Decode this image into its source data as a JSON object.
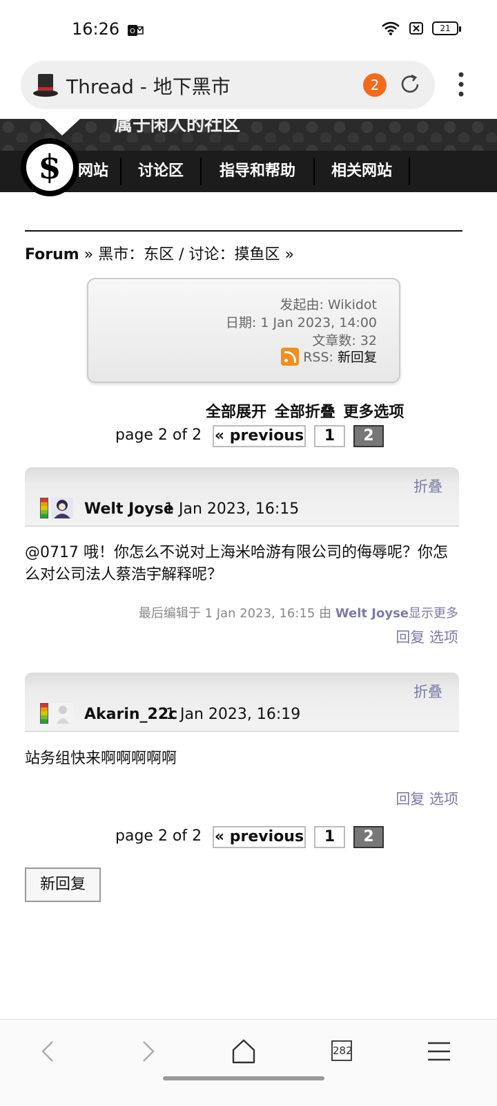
{
  "status": {
    "time": "16:26",
    "battery": "21"
  },
  "browser": {
    "title": "Thread - 地下黑市",
    "tab_badge": "2",
    "tabs_count": "282"
  },
  "site": {
    "slogan": "属于闲人的社区",
    "nav": [
      "网站",
      "讨论区",
      "指导和帮助",
      "相关网站"
    ],
    "logo_glyph": "$"
  },
  "breadcrumb": {
    "root": "Forum",
    "sep1": "»",
    "path": "黑市：东区 / 讨论：摸鱼区",
    "sep2": "»"
  },
  "thread_info": {
    "started_by": "发起由: Wikidot",
    "date": "日期: 1 Jan 2023, 14:00",
    "posts": "文章数: 32",
    "rss_label": "RSS:",
    "rss_link": "新回复"
  },
  "thread_options": {
    "unfold": "全部展开",
    "fold": "全部折叠",
    "more": "更多选项"
  },
  "pager": {
    "label": "page 2 of 2",
    "previous": "« previous",
    "page1": "1",
    "page2": "2"
  },
  "posts": [
    {
      "fold": "折叠",
      "author": "Welt Joyse",
      "date": "1 Jan 2023, 16:15",
      "body": "@0717 哦！你怎么不说对上海米哈游有限公司的侮辱呢？你怎么对公司法人蔡浩宇解释呢？",
      "edit_prefix": "最后编辑于 1 Jan 2023, 16:15 由",
      "edit_by": "Welt Joyse",
      "edit_more": "显示更多",
      "reply": "回复",
      "options": "选项"
    },
    {
      "fold": "折叠",
      "author": "Akarin_22c",
      "date": "1 Jan 2023, 16:19",
      "body": "站务组快来啊啊啊啊啊",
      "reply": "回复",
      "options": "选项"
    }
  ],
  "new_reply_button": "新回复",
  "colors": {
    "accent_link": "#7b7ba6",
    "badge": "#f26b1d",
    "nav_bg": "#1c1c1c"
  }
}
